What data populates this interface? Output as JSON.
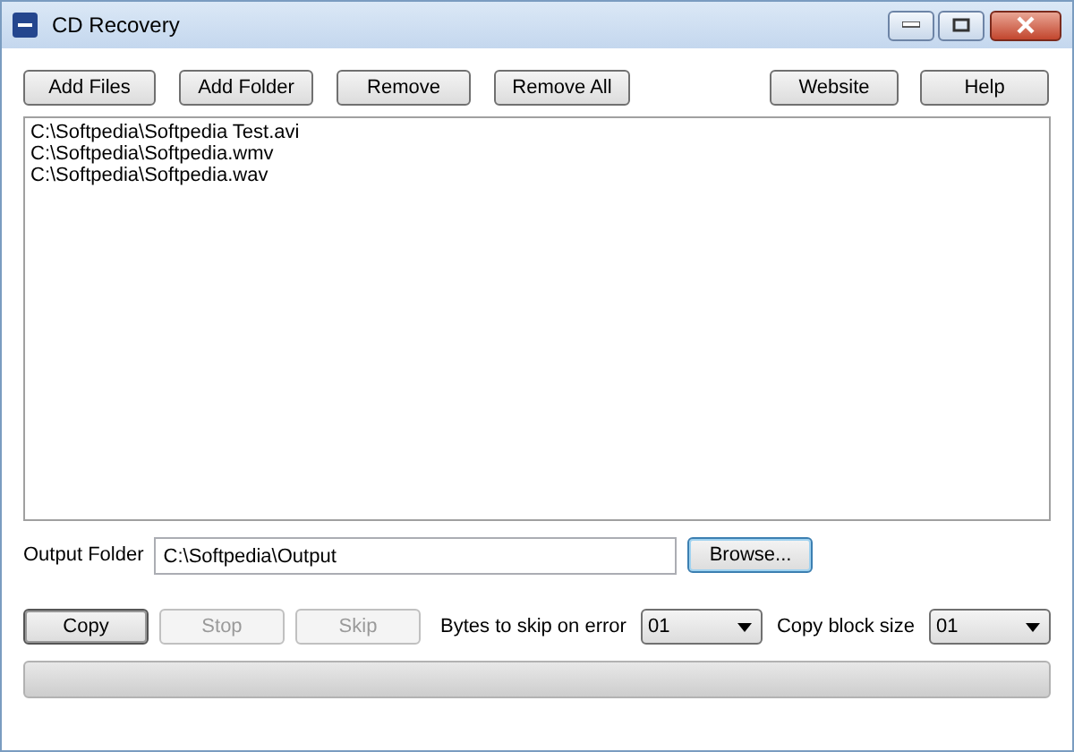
{
  "window": {
    "title": "CD Recovery"
  },
  "toolbar": {
    "left": [
      {
        "label": "Add Files"
      },
      {
        "label": "Add Folder"
      },
      {
        "label": "Remove"
      },
      {
        "label": "Remove All"
      }
    ],
    "right": [
      {
        "label": "Website"
      },
      {
        "label": "Help"
      }
    ]
  },
  "file_list": [
    "C:\\Softpedia\\Softpedia Test.avi",
    "C:\\Softpedia\\Softpedia.wmv",
    "C:\\Softpedia\\Softpedia.wav"
  ],
  "output": {
    "label": "Output Folder",
    "value": "C:\\Softpedia\\Output",
    "browse": {
      "label": "Browse...",
      "focused": true
    }
  },
  "actions": [
    {
      "label": "Copy",
      "disabled": false
    },
    {
      "label": "Stop",
      "disabled": true
    },
    {
      "label": "Skip",
      "disabled": true
    }
  ],
  "options": [
    {
      "label": "Bytes to skip on error",
      "value": "01"
    },
    {
      "label": "Copy block size",
      "value": "01"
    }
  ],
  "progress": {
    "level": 0
  }
}
